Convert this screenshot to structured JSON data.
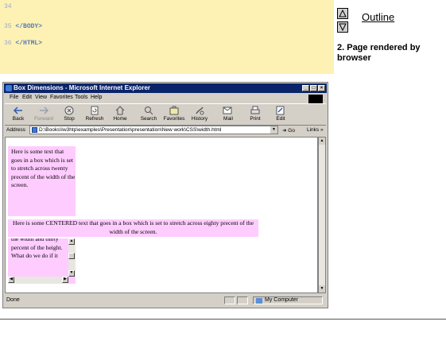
{
  "code_lines": [
    {
      "number": "34",
      "text": ""
    },
    {
      "number": "35",
      "text": "</BODY>"
    },
    {
      "number": "36",
      "text": "</HTML>"
    }
  ],
  "outline": {
    "link": "Outline",
    "caption": "2.  Page rendered by browser"
  },
  "browser": {
    "title": "Box Dimensions - Microsoft Internet Explorer",
    "window_buttons": [
      "_",
      "□",
      "×"
    ],
    "menu": [
      "File",
      "Edit",
      "View",
      "Favorites",
      "Tools",
      "Help"
    ],
    "toolbar": [
      {
        "label": "Back",
        "icon": "back-arrow-icon"
      },
      {
        "label": "Forward",
        "icon": "forward-arrow-icon"
      },
      {
        "label": "Stop",
        "icon": "stop-icon"
      },
      {
        "label": "Refresh",
        "icon": "refresh-icon"
      },
      {
        "label": "Home",
        "icon": "home-icon"
      },
      {
        "label": "Search",
        "icon": "search-icon"
      },
      {
        "label": "Favorites",
        "icon": "favorites-icon"
      },
      {
        "label": "History",
        "icon": "history-icon"
      },
      {
        "label": "Mail",
        "icon": "mail-icon"
      },
      {
        "label": "Print",
        "icon": "print-icon"
      },
      {
        "label": "Edit",
        "icon": "edit-icon"
      }
    ],
    "address_label": "Address",
    "address_value": "D:\\Books\\Iw3htp\\examples\\Presentation\\presentation\\New work\\CSS\\width.html",
    "go_label": "Go",
    "links_label": "Links »",
    "status_text": "Done",
    "zone_text": "My Computer"
  },
  "page": {
    "box1_text": "Here is some text that goes in a box which is set to stretch across twenty precent of the width of the screen.",
    "box2_text": "Here is some CENTERED text that goes in a box which is set to stretch across eighty precent of the width of the screen.",
    "box3_text": "the width and thirty percent of the height. What do we do if it"
  },
  "colors": {
    "code_background": "#fdf2b4",
    "box_background": "#ffccff",
    "titlebar": "#0a246a"
  }
}
